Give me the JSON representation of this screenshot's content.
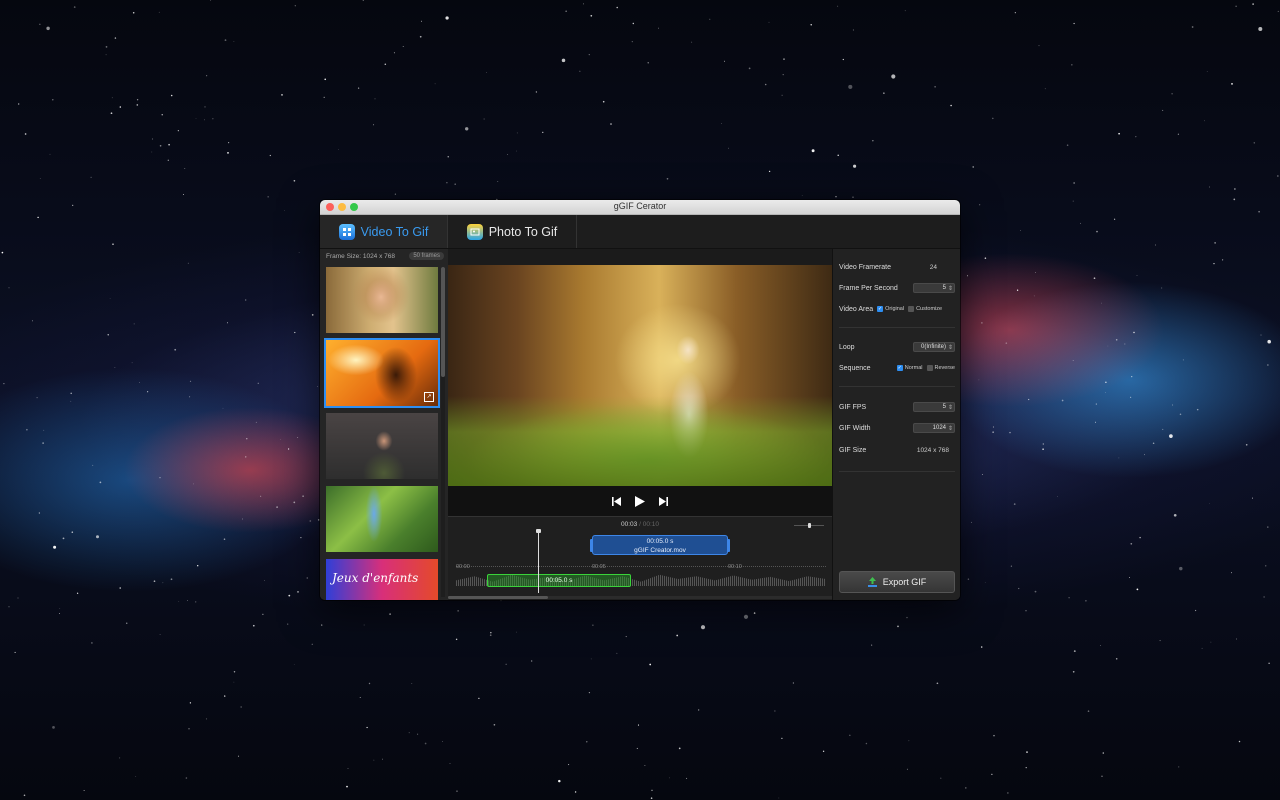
{
  "window": {
    "title": "gGIF Cerator"
  },
  "tabs": [
    {
      "label": "Video To Gif",
      "icon": "video-grid-icon"
    },
    {
      "label": "Photo To Gif",
      "icon": "photo-icon"
    }
  ],
  "left": {
    "frame_size": "Frame Size: 1024 x 768",
    "frames_badge": "50 frames",
    "last_thumb_text": "Jeux d'enfants"
  },
  "timeline": {
    "current": "00:03",
    "separator": "/",
    "duration": "00:10",
    "clip_time": "00:05.0 s",
    "clip_name": "gGIF Creator.mov",
    "ticks": [
      "00:00",
      "00:05",
      "00:10"
    ],
    "audio_clip_time": "00:05.0 s"
  },
  "settings": {
    "video_framerate_label": "Video Framerate",
    "video_framerate_value": "24",
    "fps_label": "Frame Per Second",
    "fps_value": "5",
    "video_area_label": "Video Area",
    "original_label": "Original",
    "customize_label": "Customize",
    "loop_label": "Loop",
    "loop_value": "0(Infinite)",
    "sequence_label": "Sequence",
    "normal_label": "Normal",
    "reverse_label": "Reverse",
    "gif_fps_label": "GIF FPS",
    "gif_fps_value": "5",
    "gif_width_label": "GIF Width",
    "gif_width_value": "1024",
    "gif_size_label": "GIF Size",
    "gif_size_value": "1024 x 768",
    "export_label": "Export GIF"
  },
  "colors": {
    "accent": "#2d8ef2",
    "clip_green": "#3ad33a"
  }
}
